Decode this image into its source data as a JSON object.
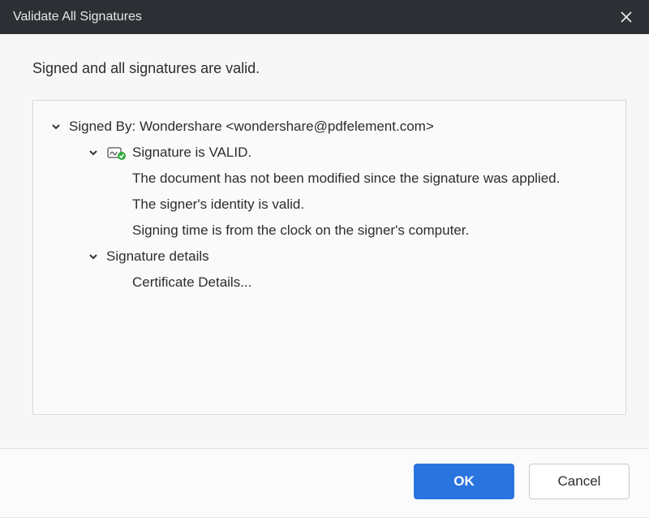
{
  "dialog": {
    "title": "Validate All Signatures",
    "summary": "Signed and all signatures are valid."
  },
  "tree": {
    "signed_by_label": "Signed By: Wondershare <wondershare@pdfelement.com>",
    "sig_valid": "Signature is VALID.",
    "line_not_modified": "The document has not been modified since the signature was applied.",
    "line_identity": "The signer's identity is valid.",
    "line_time": "Signing time is from the clock on the signer's computer.",
    "sig_details": "Signature details",
    "cert_details": "Certificate Details..."
  },
  "buttons": {
    "ok": "OK",
    "cancel": "Cancel"
  }
}
